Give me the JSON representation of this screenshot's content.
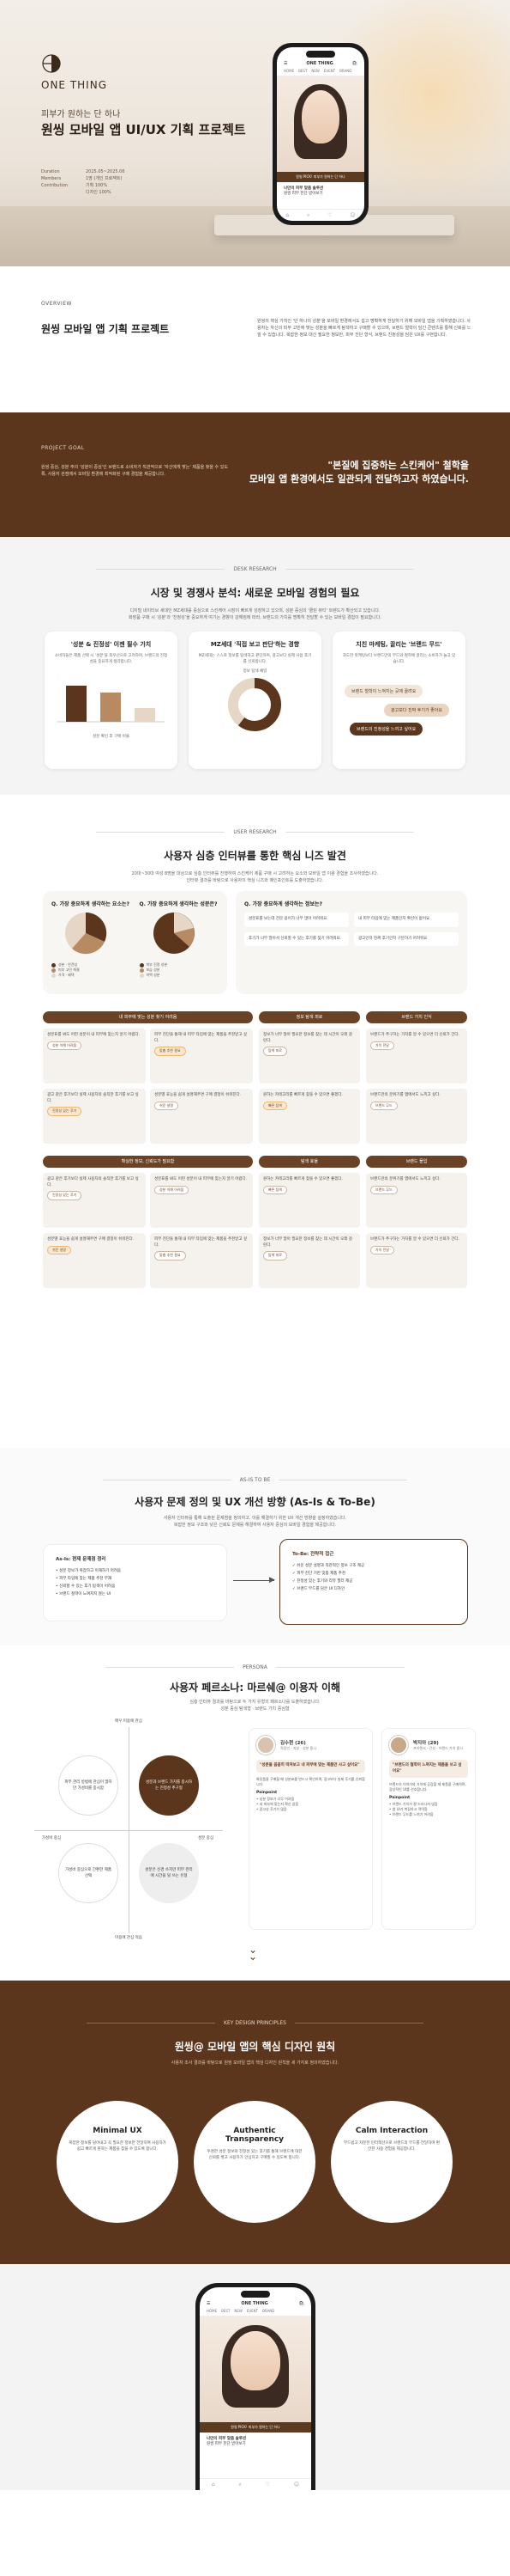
{
  "hero": {
    "brand": "ONE THING",
    "subtitle": "피부가 원하는 단 하나",
    "title": "원씽 모바일 앱 UI/UX 기획 프로젝트",
    "meta": [
      {
        "k": "Duration",
        "v": "2025.05~2025.06"
      },
      {
        "k": "Members",
        "v": "1명 (개인 프로젝트)"
      },
      {
        "k": "Contribution",
        "v": "기획 100%"
      },
      {
        "k": "",
        "v": "디자인 100%"
      }
    ]
  },
  "phone": {
    "logo": "ONE THING",
    "tabs": [
      "HOME",
      "BEST",
      "NEW",
      "EVENT",
      "BRAND"
    ],
    "banner": "원씽 PICK! 피부가 원하는 단 하나",
    "card_title": "나만의 피부 맞춤 솔루션",
    "card_sub": "원씽 피부 진단 받아보기"
  },
  "overview": {
    "label": "OVERVIEW",
    "title": "원씽 모바일 앱 기획 프로젝트",
    "text": "원씽의 핵심 가치인 '단 하나의 성분'을 모바일 환경에서도 쉽고 명확하게 전달하기 위해 모바일 앱을 기획하였습니다. 사용자는 자신의 피부 고민에 맞는 성분을 빠르게 탐색하고 구매할 수 있으며, 브랜드 철학이 담긴 콘텐츠를 통해 신뢰를 느낄 수 있습니다. 복잡한 정보 대신 필요한 정보만, 피부 진단 형식, 브랜드 진정성을 담은 UX를 구현합니다."
  },
  "goal": {
    "label": "PROJECT GOAL",
    "text": "원씽 중심, 성분 주의 '성분이 중심'인 브랜드로 소비자가 직관적으로 '자신에게 맞는' 제품을 찾을 수 있도록, 사용자 관점에서 모바일 환경에 최적화된 구매 경험을 제공합니다.",
    "quote_1": "\"본질에 집중하는 스킨케어\" 철학을",
    "quote_2": "모바일 앱 환경에서도 일관되게 전달하고자 하였습니다."
  },
  "desk": {
    "label": "DESK RESEARCH",
    "title": "시장 및 경쟁사 분석: 새로운 모바일 경험의 필요",
    "desc_1": "디지털 네이티브 세대인 MZ세대를 중심으로 스킨케어 시장이 빠르게 성장하고 있으며, 성분 중심의 '클린 뷰티' 트렌드가 확산되고 있습니다.",
    "desc_2": "화장품 구매 시 '성분'과 '진정성'을 중요하게 여기는 경향이 강해짐에 따라, 브랜드의 가치를 명확히 전달할 수 있는 모바일 경험이 필요합니다.",
    "cards": [
      {
        "title": "'성분 & 진정성' 이젠 필수 가치",
        "desc": "소비자들은 제품 선택 시 '성분'을 최우선으로 고려하며, 브랜드의 진정성을 중요하게 생각합니다."
      },
      {
        "title": "MZ세대 '직접 보고 판단'하는 경향",
        "desc": "MZ세대는 스스로 정보를 탐색하고 판단하며, 광고보다 실제 사용 후기를 신뢰합니다."
      },
      {
        "title": "지친 마케팅, 끌리는 '브랜드 무드'",
        "desc": "과도한 마케팅보다 브랜드만의 무드와 철학에 끌리는 소비자가 늘고 있습니다."
      }
    ],
    "bar_caption": "성분 확인 후 구매 비율",
    "donut_caption": "정보 탐색 채널",
    "bubbles": [
      "브랜드 철학이 느껴지는 곳에 끌려요",
      "광고보다 진짜 후기가 좋아요",
      "브랜드의 진정성을 느끼고 싶어요"
    ]
  },
  "user": {
    "label": "USER RESEARCH",
    "title": "사용자 심층 인터뷰를 통한 핵심 니즈 발견",
    "desc_1": "20대~30대 여성 8명을 대상으로 심층 인터뷰를 진행하여 스킨케어 제품 구매 시 고려하는 요소와 모바일 앱 이용 경험을 조사하였습니다.",
    "desc_2": "인터뷰 결과를 바탕으로 사용자의 핵심 니즈와 페인포인트를 도출하였습니다.",
    "q1": "Q. 가장 중요하게 생각하는 요소는?",
    "q2": "Q. 가장 중요하게 생각하는 성분은?",
    "q3": "Q. 가장 중요하게 생각하는 정보는?",
    "legend1": [
      "성분 · 안전성",
      "피부 고민 해결",
      "가격 · 혜택",
      "브랜드 신뢰도"
    ],
    "legend2": [
      "피부 진정 성분",
      "보습 성분",
      "미백 성분",
      "기타"
    ],
    "quotes": [
      "성분표를 보는데 전문 용어가 너무 많아 어려워요.",
      "내 피부 타입에 맞는 제품인지 확신이 없어요.",
      "후기가 너무 많아서 신뢰할 수 있는 후기를 찾기 어려워요.",
      "광고인지 진짜 후기인지 구분하기 어려워요."
    ],
    "headers": [
      "내 피부에 맞는 성분 찾기 어려움",
      "정보 탐색 피로",
      "브랜드 가치 인식",
      "확실한 정보, 신뢰도가 필요함",
      "탐색 효율",
      "브랜드 몰입"
    ],
    "cells": [
      {
        "t": "성분표를 봐도 어떤 성분이 내 피부에 맞는지 알기 어렵다.",
        "tag": "성분 이해 어려움"
      },
      {
        "t": "피부 진단을 통해 내 피부 타입에 맞는 제품을 추천받고 싶다.",
        "tag": "맞춤 추천 필요"
      },
      {
        "t": "정보가 너무 많아 필요한 정보를 찾는 데 시간이 오래 걸린다.",
        "tag": "탐색 피로"
      },
      {
        "t": "브랜드가 추구하는 가치를 알 수 있으면 더 신뢰가 간다.",
        "tag": "가치 전달"
      },
      {
        "t": "광고 같은 후기보다 실제 사용자의 솔직한 후기를 보고 싶다.",
        "tag": "진정성 있는 후기"
      },
      {
        "t": "성분별 효능을 쉽게 설명해주면 구매 결정이 쉬워진다.",
        "tag": "쉬운 설명"
      },
      {
        "t": "원하는 카테고리를 빠르게 찾을 수 있으면 좋겠다.",
        "tag": "빠른 탐색"
      },
      {
        "t": "브랜드만의 분위기를 앱에서도 느끼고 싶다.",
        "tag": "브랜드 무드"
      }
    ]
  },
  "asis": {
    "label": "AS-IS TO BE",
    "title": "사용자 문제 정의 및 UX 개선 방향 (As-Is & To-Be)",
    "desc_1": "사용자 인터뷰를 통해 도출된 문제점을 정의하고, 이를 해결하기 위한 UX 개선 방향을 설정하였습니다.",
    "desc_2": "복잡한 정보 구조와 낮은 신뢰도 문제를 해결하여 사용자 중심의 모바일 경험을 제공합니다.",
    "as_head": "As-Is: 현재 문제점 정리",
    "as_items": [
      "성분 정보가 복잡하고 이해하기 어려움",
      "피부 타입에 맞는 제품 추천 부재",
      "신뢰할 수 있는 후기 탐색이 어려움",
      "브랜드 철학이 느껴지지 않는 UI"
    ],
    "to_head": "To-Be: 전략적 접근",
    "to_items": [
      "쉬운 성분 설명과 직관적인 정보 구조 제공",
      "피부 진단 기반 맞춤 제품 추천",
      "진정성 있는 후기와 리뷰 필터 제공",
      "브랜드 무드를 담은 UI 디자인"
    ]
  },
  "persona": {
    "label": "PERSONA",
    "title": "사용자 페르소나: 마르쉐@ 이용자 이해",
    "desc_1": "심층 인터뷰 결과를 바탕으로 두 가지 유형의 페르소나를 도출하였습니다.",
    "desc_2": "성분 중심 탐색형 · 브랜드 가치 중심형",
    "axis_top": "매우 미용에 관심",
    "axis_bottom": "미용에 관심 적음",
    "axis_left": "가성비 중심",
    "axis_right": "성분 중심",
    "quads": [
      "피부 관리 방법에 관심이 많지만 가성비를 중시함",
      "성분과 브랜드 가치를 중시하는 진정성 추구형",
      "가성비 중심으로 간편한 제품 선택",
      "성분은 신경 쓰지만 피부 관리에 시간을 덜 쓰는 유형"
    ],
    "p1": {
      "name": "김수현 (26)",
      "info": "직장인 · 지성 · 성분 중시",
      "quote": "\"성분을 꼼꼼히 따져보고 내 피부에 맞는 제품만 사고 싶어요\"",
      "desc": "화장품을 구매할 때 성분표를 반드시 확인하며, 광고보다 실제 후기를 신뢰합니다.",
      "pain_h": "Painpoint",
      "pain": [
        "성분 정보가 너무 어려움",
        "내 피부에 맞는지 확신 없음",
        "광고성 후기가 많음"
      ]
    },
    "p2": {
      "name": "박지아 (29)",
      "info": "프리랜서 · 건성 · 브랜드 가치 중시",
      "quote": "\"브랜드의 철학이 느껴지는 제품을 쓰고 싶어요\"",
      "desc": "브랜드의 이야기와 가치에 공감할 때 제품을 구매하며, 감성적인 UI를 선호합니다.",
      "pain_h": "Painpoint",
      "pain": [
        "브랜드 가치가 잘 드러나지 않음",
        "앱 UI가 복잡하고 딱딱함",
        "브랜드 무드를 느끼기 어려움"
      ]
    }
  },
  "kdp": {
    "label": "KEY DESIGN PRINCIPLES",
    "title": "원씽@ 모바일 앱의 핵심 디자인 원칙",
    "desc": "사용자 조사 결과를 바탕으로 원씽 모바일 앱의 핵심 디자인 원칙을 세 가지로 정의하였습니다.",
    "items": [
      {
        "t": "Minimal UX",
        "d": "복잡한 정보를 덜어내고 꼭 필요한 정보만 전달하여 사용자가 쉽고 빠르게 원하는 제품을 찾을 수 있도록 합니다."
      },
      {
        "t": "Authentic Transparency",
        "d": "투명한 성분 정보와 진정성 있는 후기를 통해 브랜드에 대한 신뢰를 쌓고 사용자가 안심하고 구매할 수 있도록 합니다."
      },
      {
        "t": "Calm Interaction",
        "d": "부드럽고 차분한 인터랙션으로 브랜드의 무드를 전달하며 편안한 사용 경험을 제공합니다."
      }
    ]
  },
  "colors": {
    "brown": "#5b361d",
    "accent": "#e8b874",
    "bg": "#f4f4f4"
  }
}
